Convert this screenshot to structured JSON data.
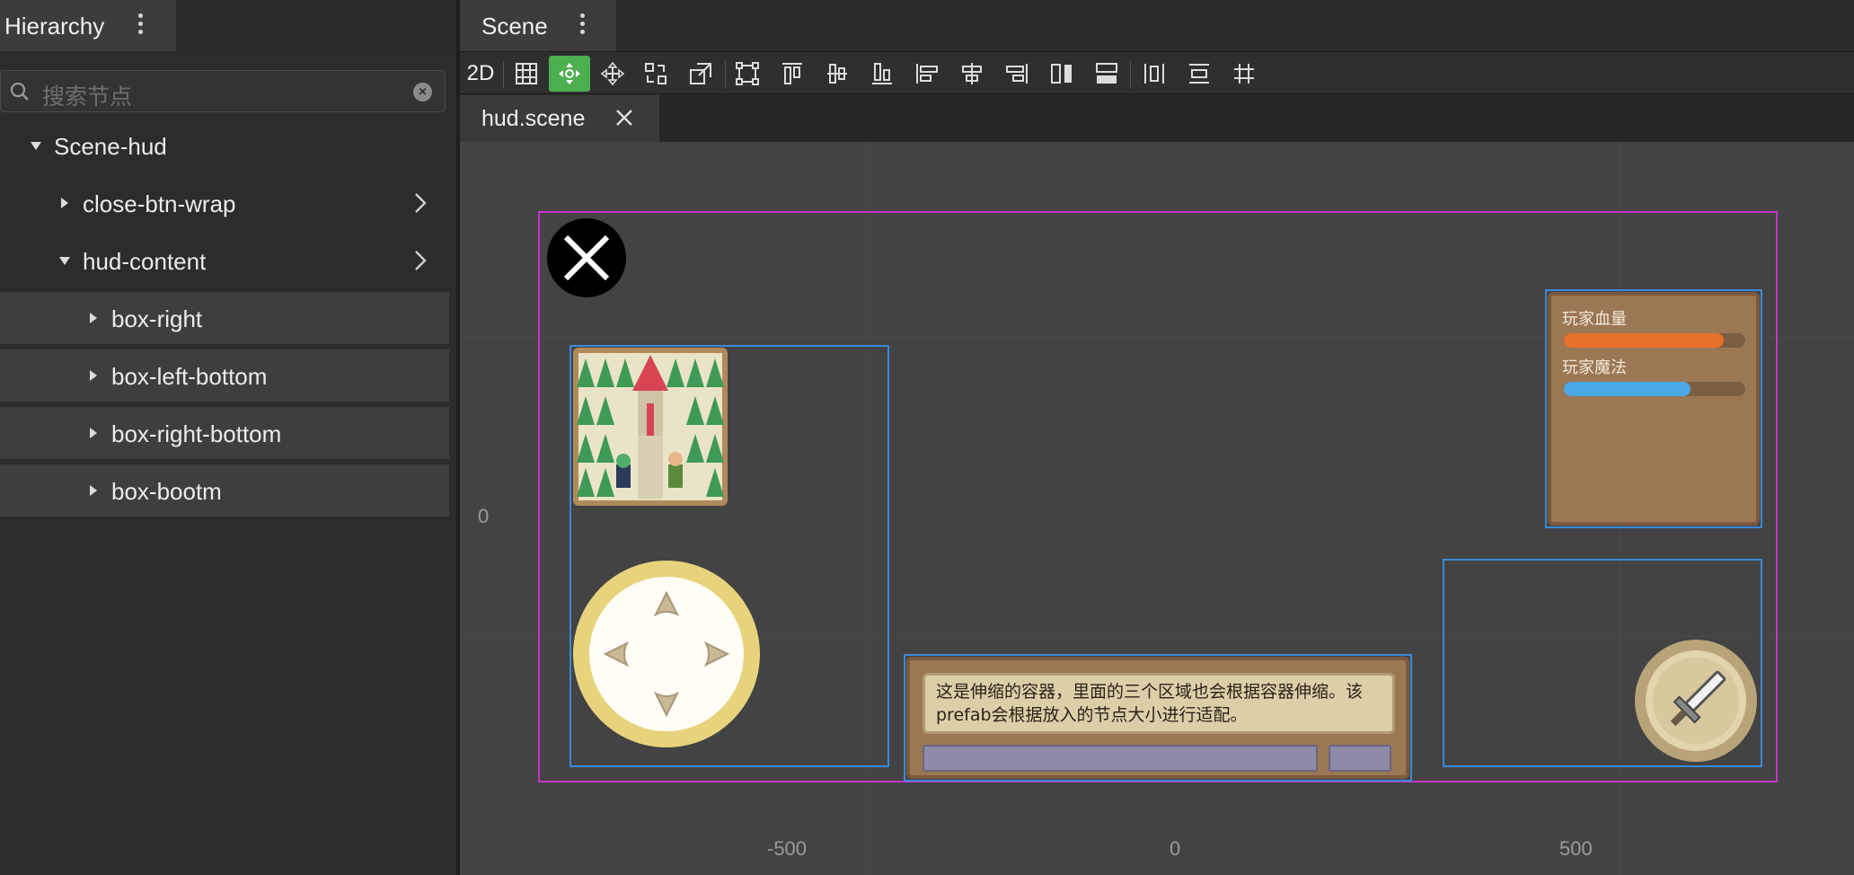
{
  "hierarchy": {
    "title": "Hierarchy",
    "search_placeholder": "搜索节点",
    "nodes": [
      {
        "label": "Scene-hud"
      },
      {
        "label": "close-btn-wrap"
      },
      {
        "label": "hud-content"
      },
      {
        "label": "box-right"
      },
      {
        "label": "box-left-bottom"
      },
      {
        "label": "box-right-bottom"
      },
      {
        "label": "box-bootm"
      }
    ]
  },
  "scene": {
    "title": "Scene",
    "toolbar": {
      "mode_2d": "2D",
      "icons": [
        "grid-icon",
        "move-gizmo-icon",
        "move-icon",
        "rotate-icon",
        "scale-icon",
        "rect-icon",
        "align-top-icon",
        "align-v-center-icon",
        "align-bottom-icon",
        "align-left-icon",
        "align-h-center-icon",
        "align-right-icon",
        "distribute-h-icon",
        "distribute-v-icon",
        "distribute-h-center-icon",
        "distribute-v-center-icon",
        "snap-grid-icon"
      ]
    },
    "tab": {
      "name": "hud.scene"
    },
    "rulers": {
      "y_zero": "0",
      "x_labels": [
        "-500",
        "0",
        "500"
      ]
    },
    "hud": {
      "hp_label": "玩家血量",
      "hp_value": 0.88,
      "mp_label": "玩家魔法",
      "mp_value": 0.7,
      "message": "这是伸缩的容器，里面的三个区域也会根据容器伸缩。该prefab会根据放入的节点大小进行适配。"
    }
  },
  "colors": {
    "accent_active": "#4caf50",
    "canvas_frame": "#c832c8",
    "box_outline": "#3a8ad8",
    "hp_bar": "#e8702a",
    "mp_bar": "#4aa8e6"
  }
}
